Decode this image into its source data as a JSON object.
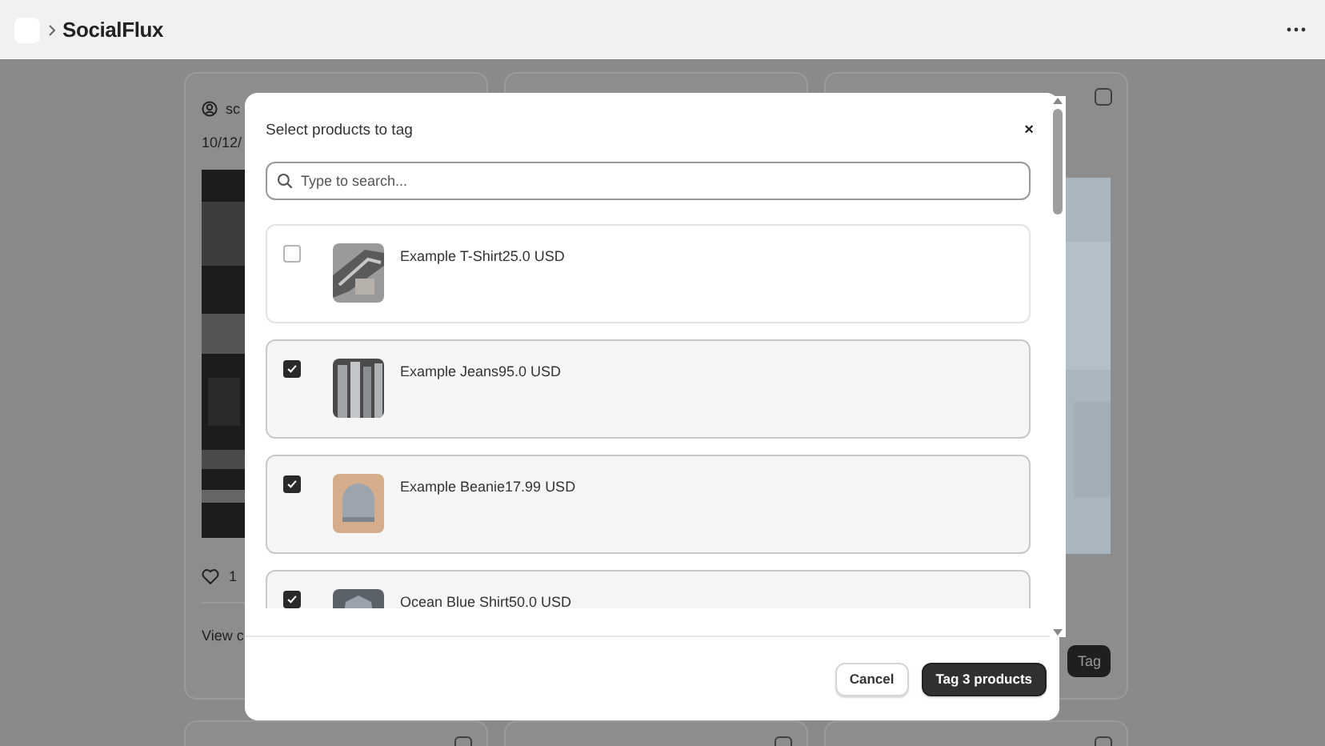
{
  "app": {
    "title": "SocialFlux"
  },
  "post_cards": [
    {
      "user": "sc",
      "date": "10/12/",
      "likes": "1",
      "view_link": "View c",
      "kind": "photo-left"
    },
    {
      "kind": "empty"
    },
    {
      "checked": false,
      "kind": "photo-right",
      "tag_button": "Tag"
    },
    {
      "checked": false,
      "kind": "empty"
    },
    {
      "checked": false,
      "kind": "empty"
    },
    {
      "checked": false,
      "kind": "empty"
    }
  ],
  "modal": {
    "title": "Select products to tag",
    "close": "×",
    "search": {
      "placeholder": "Type to search..."
    },
    "products": [
      {
        "name": "Example T-Shirt25.0 USD",
        "checked": false,
        "kind": "shirt"
      },
      {
        "name": "Example Jeans95.0 USD",
        "checked": true,
        "kind": "jeans"
      },
      {
        "name": "Example Beanie17.99 USD",
        "checked": true,
        "kind": "beanie"
      },
      {
        "name": "Ocean Blue Shirt50.0 USD",
        "checked": true,
        "kind": "shirt-blue"
      }
    ],
    "buttons": {
      "cancel": "Cancel",
      "confirm": "Tag 3 products"
    }
  }
}
